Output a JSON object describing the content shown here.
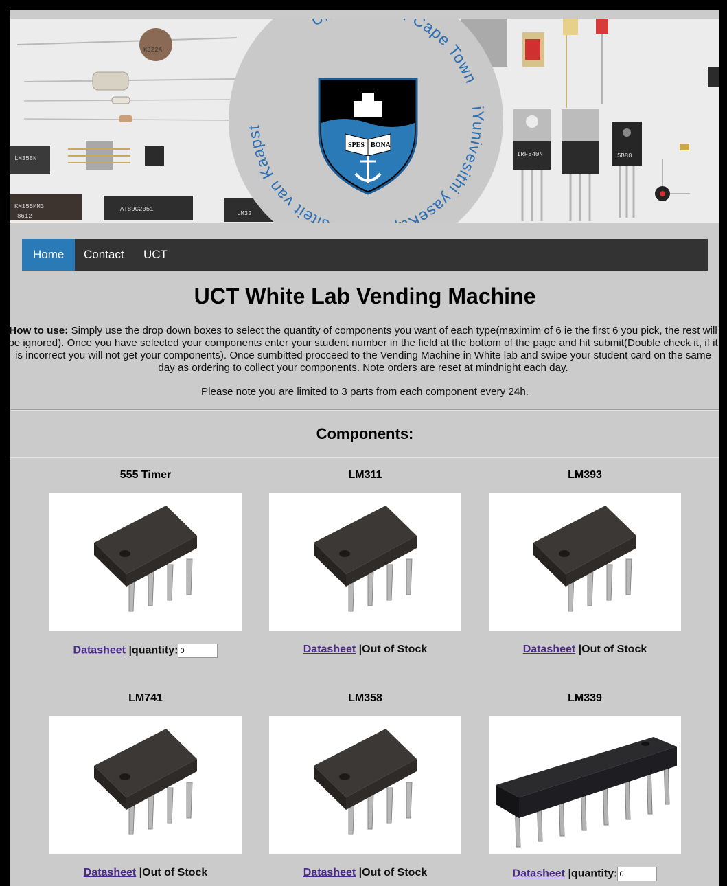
{
  "banner": {
    "seal_text_top": "University of Cape Town",
    "seal_text_right": "iYunivesithi yaseKapa",
    "seal_text_bottom": "Universiteit van Kaapstad",
    "motto_left": "SPES",
    "motto_right": "BONA",
    "colors": {
      "seal_blue": "#2c6fb3",
      "shield_blue": "#2a7ab8"
    }
  },
  "nav": {
    "items": [
      {
        "label": "Home",
        "active": true
      },
      {
        "label": "Contact",
        "active": false
      },
      {
        "label": "UCT",
        "active": false
      }
    ],
    "active_color": "#2a7ab8"
  },
  "page": {
    "title": "UCT White Lab Vending Machine",
    "howto_label": "How to use:",
    "howto_text": " Simply use the drop down boxes to select the quantity of components you want of each type(maximim of 6 ie the first 6 you pick, the rest will be ignored). Once you have selected your components enter your student number in the field at the bottom of the page and hit submit(Double check it, if it is incorrect you will not get your components). Once sumbitted procceed to the Vending Machine in White lab and swipe your student card on the same day as ordering to collect your components. Note orders are reset at mindnight each day.",
    "limit_text": "Please note you are limited to 3 parts from each component every 24h.",
    "components_heading": "Components:"
  },
  "products": [
    {
      "name": "555 Timer",
      "datasheet_label": "Datasheet",
      "separator": " |",
      "status": "quantity:",
      "in_stock": true,
      "quantity_value": "0",
      "image": "dip8-chip-icon"
    },
    {
      "name": "LM311",
      "datasheet_label": "Datasheet",
      "separator": " |",
      "status": "Out of Stock",
      "in_stock": false,
      "image": "dip8-chip-icon"
    },
    {
      "name": "LM393",
      "datasheet_label": "Datasheet",
      "separator": " |",
      "status": "Out of Stock",
      "in_stock": false,
      "image": "dip8-chip-icon"
    },
    {
      "name": "LM741",
      "datasheet_label": "Datasheet",
      "separator": " |",
      "status": "Out of Stock",
      "in_stock": false,
      "image": "dip8-chip-icon"
    },
    {
      "name": "LM358",
      "datasheet_label": "Datasheet",
      "separator": " |",
      "status": "Out of Stock",
      "in_stock": false,
      "image": "dip8-chip-icon"
    },
    {
      "name": "LM339",
      "datasheet_label": "Datasheet",
      "separator": " |",
      "status": "quantity:",
      "in_stock": true,
      "quantity_value": "0",
      "image": "dip14-chip-icon"
    }
  ]
}
